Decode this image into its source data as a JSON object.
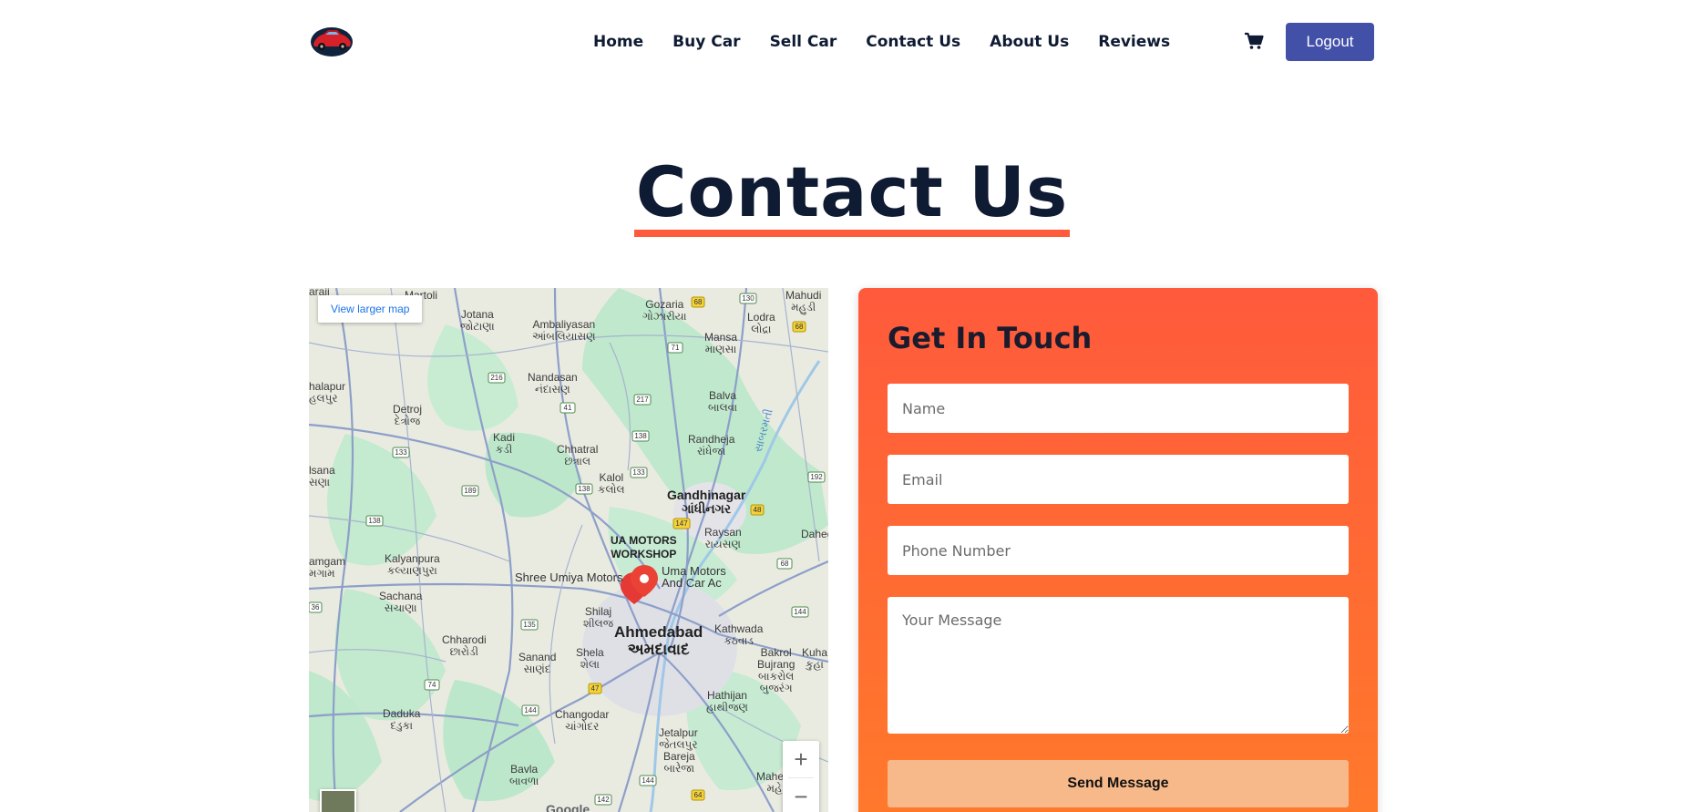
{
  "header": {
    "logo_icon": "red-car-logo-icon",
    "nav": [
      {
        "label": "Home"
      },
      {
        "label": "Buy Car"
      },
      {
        "label": "Sell Car"
      },
      {
        "label": "Contact Us"
      },
      {
        "label": "About Us"
      },
      {
        "label": "Reviews"
      }
    ],
    "cart_icon": "shopping-cart-icon",
    "logout_label": "Logout"
  },
  "page": {
    "title": "Contact Us",
    "accent_color": "#ff5a3c"
  },
  "map": {
    "view_larger_label": "View larger map",
    "zoom_in": "+",
    "zoom_out": "−",
    "attribution": "Google",
    "labels": {
      "ahmedabad_en": "Ahmedabad",
      "ahmedabad_gu": "અમદાવાદ",
      "gandhinagar_en": "Gandhinagar",
      "gandhinagar_gu": "ગાંધીનગર",
      "ua_motors": "UA MOTORS\nWORKSHOP",
      "shree_umiya": "Shree Umiya Motors",
      "uma_motors": "Uma Motors\nAnd Car Ac",
      "martoli": "Martoli",
      "jotana": "Jotana\nજોટાણા",
      "ambaliyasan": "Ambaliyasan\nઆંબલિયાસણ",
      "gozaria": "Gozaria\nગોઝારીયા",
      "lodra": "Lodra\nલોદ્રા",
      "mahudi": "Mahudi\nમહુડી",
      "mansa": "Mansa\nમાણસા",
      "nandasan": "Nandasan\nનંદાસણ",
      "balva": "Balva\nબાલવા",
      "detroj": "Detroj\nદેત્રોજ",
      "kadi": "Kadi\nકડી",
      "chhatral": "Chhatral\nછત્રાલ",
      "randheja": "Randheja\nરાંધેજા",
      "kalol": "Kalol\nકલોલ",
      "raysan": "Raysan\nરાયસણ",
      "dahegam": "Daheg",
      "kalyanpura": "Kalyanpura\nકલ્યાણપુરા",
      "sachana": "Sachana\nસચાણા",
      "shilaj": "Shilaj\nશીલજ",
      "kathwada": "Kathwada\nકઠવાડ",
      "chharodi": "Chharodi\nછારોડી",
      "sanand": "Sanand\nસાણંદ",
      "shela": "Shela\nશેલા",
      "bakrol": "Bakrol\nBujrang\nબાકરોલ\nબુજરંગ",
      "kuha": "Kuha\nકુહા",
      "hathijan": "Hathijan\nહાથીજણ",
      "daduka": "Daduka\nદડુકા",
      "changodar": "Changodar\nચાંગોદર",
      "jetalpur": "Jetalpur\nજેતલપુર",
      "bareja": "Bareja\nબારેજા",
      "bavla": "Bavla\nબાવળા",
      "mahem": "Mahem\nમહે",
      "halapur": "halapur\nહલપુર",
      "isana": "lsana\nસણા",
      "amgam": "amgam\nમગામ",
      "araji": "araji",
      "sabarmati": "સાબરમતી"
    }
  },
  "form": {
    "heading": "Get In Touch",
    "name_placeholder": "Name",
    "email_placeholder": "Email",
    "phone_placeholder": "Phone Number",
    "message_placeholder": "Your Message",
    "send_label": "Send Message"
  }
}
